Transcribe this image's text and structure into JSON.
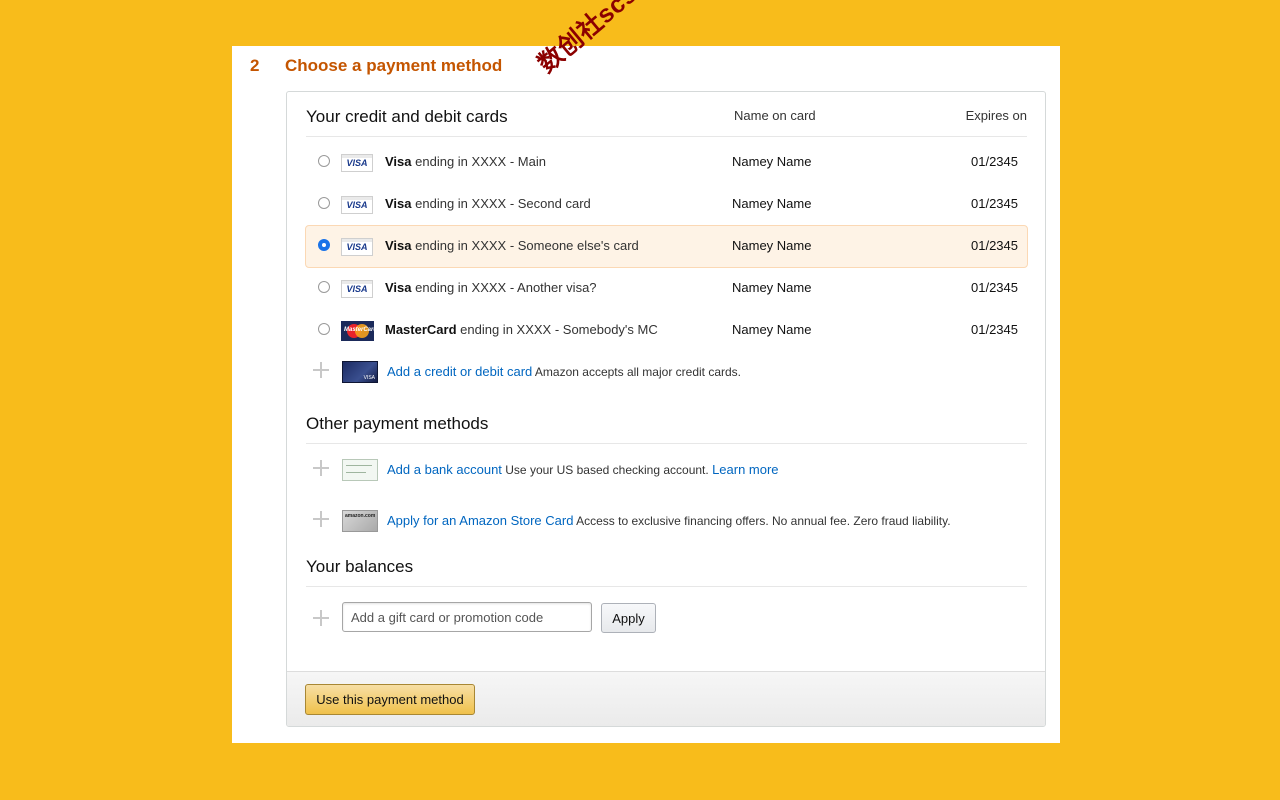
{
  "step": {
    "number": "2",
    "title": "Choose a payment method"
  },
  "watermark": "数创社scs66",
  "cards_section": {
    "title": "Your credit and debit cards",
    "col_name": "Name on card",
    "col_expires": "Expires on",
    "cards": [
      {
        "brand": "Visa",
        "suffix": "ending in XXXX - Main",
        "name": "Namey Name",
        "expires": "01/2345",
        "selected": false,
        "logo": "VISA"
      },
      {
        "brand": "Visa",
        "suffix": "ending in XXXX - Second card",
        "name": "Namey Name",
        "expires": "01/2345",
        "selected": false,
        "logo": "VISA"
      },
      {
        "brand": "Visa",
        "suffix": "ending in XXXX - Someone else's card",
        "name": "Namey Name",
        "expires": "01/2345",
        "selected": true,
        "logo": "VISA"
      },
      {
        "brand": "Visa",
        "suffix": "ending in XXXX - Another visa?",
        "name": "Namey Name",
        "expires": "01/2345",
        "selected": false,
        "logo": "VISA"
      },
      {
        "brand": "MasterCard",
        "suffix": "ending in XXXX - Somebody's MC",
        "name": "Namey Name",
        "expires": "01/2345",
        "selected": false,
        "logo": "MasterCard"
      }
    ],
    "add_card": {
      "link": "Add a credit or debit card",
      "note": "Amazon accepts all major credit cards.",
      "thumb_text": "VISA"
    }
  },
  "other_section": {
    "title": "Other payment methods",
    "bank": {
      "link": "Add a bank account",
      "note": "Use your US based checking account.",
      "learn_more": "Learn more"
    },
    "store_card": {
      "link": "Apply for an Amazon Store Card",
      "note": "Access to exclusive financing offers. No annual fee. Zero fraud liability.",
      "thumb_text": "amazon.com"
    }
  },
  "balances_section": {
    "title": "Your balances",
    "gift_placeholder": "Add a gift card or promotion code",
    "apply_label": "Apply"
  },
  "footer": {
    "use_button": "Use this payment method"
  },
  "colors": {
    "background": "#f8bc1b",
    "heading": "#c45500",
    "link": "#0066c0",
    "selected_bg": "#fef3e6",
    "radio_on": "#1a73e8"
  }
}
